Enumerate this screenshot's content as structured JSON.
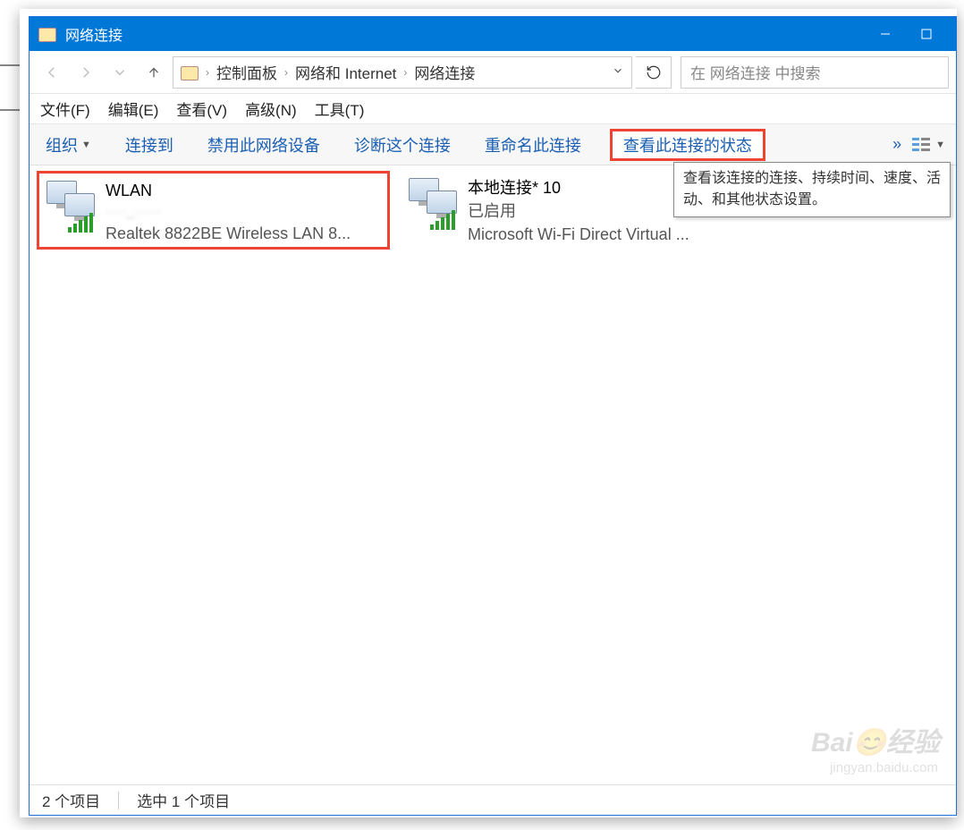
{
  "window": {
    "title": "网络连接"
  },
  "breadcrumb": {
    "items": [
      "控制面板",
      "网络和 Internet",
      "网络连接"
    ]
  },
  "search": {
    "placeholder": "在 网络连接 中搜索"
  },
  "menu": {
    "file": "文件(F)",
    "edit": "编辑(E)",
    "view": "查看(V)",
    "advanced": "高级(N)",
    "tools": "工具(T)"
  },
  "toolbar": {
    "organize": "组织",
    "connect_to": "连接到",
    "disable_device": "禁用此网络设备",
    "diagnose": "诊断这个连接",
    "rename": "重命名此连接",
    "view_status": "查看此连接的状态",
    "overflow": "»"
  },
  "tooltip": {
    "text": "查看该连接的连接、持续时间、速度、活动、和其他状态设置。"
  },
  "connections": [
    {
      "name": "WLAN",
      "ssid_blurred": "····_·····",
      "device": "Realtek 8822BE Wireless LAN 8..."
    },
    {
      "name": "本地连接* 10",
      "status": "已启用",
      "device": "Microsoft Wi-Fi Direct Virtual ..."
    }
  ],
  "statusbar": {
    "items_count": "2 个项目",
    "selected": "选中 1 个项目"
  },
  "watermark": {
    "main": "Bai😊经验",
    "sub": "jingyan.baidu.com"
  }
}
